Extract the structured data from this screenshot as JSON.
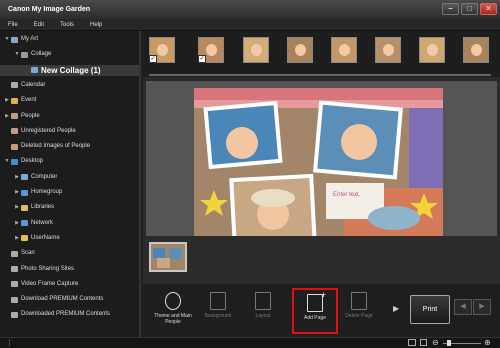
{
  "window": {
    "title": "Canon My Image Garden"
  },
  "menu": [
    "File",
    "Edit",
    "Tools",
    "Help"
  ],
  "tree": [
    {
      "label": "My Art",
      "tri": "▼",
      "indent": 1,
      "color": "#8aa6cf"
    },
    {
      "label": "Collage",
      "tri": "▼",
      "indent": 2,
      "color": "#9b9b9b"
    },
    {
      "label": "New Collage (1)",
      "tri": "",
      "indent": 3,
      "color": "#7da7d9",
      "selected": true
    },
    {
      "label": "Calendar",
      "tri": "",
      "indent": 1,
      "color": "#aaaaaa"
    },
    {
      "label": "Event",
      "tri": "▶",
      "indent": 1,
      "color": "#e0b04a"
    },
    {
      "label": "People",
      "tri": "▶",
      "indent": 1,
      "color": "#c59a80"
    },
    {
      "label": "Unregistered People",
      "tri": "",
      "indent": 1,
      "color": "#c59a80"
    },
    {
      "label": "Deleted Images of People",
      "tri": "",
      "indent": 1,
      "color": "#c59a80"
    },
    {
      "label": "Desktop",
      "tri": "▼",
      "indent": 1,
      "color": "#4a88d6"
    },
    {
      "label": "Computer",
      "tri": "▶",
      "indent": 2,
      "color": "#7fa8d6"
    },
    {
      "label": "Homegroup",
      "tri": "▶",
      "indent": 2,
      "color": "#5a96d6"
    },
    {
      "label": "Libraries",
      "tri": "▶",
      "indent": 2,
      "color": "#e0c050"
    },
    {
      "label": "Network",
      "tri": "▶",
      "indent": 2,
      "color": "#5a96d6"
    },
    {
      "label": "UserName",
      "tri": "▶",
      "indent": 2,
      "color": "#e0c050"
    },
    {
      "label": "Scan",
      "tri": "",
      "indent": 1,
      "color": "#aaaaaa"
    },
    {
      "label": "Photo Sharing Sites",
      "tri": "",
      "indent": 1,
      "color": "#aaaaaa"
    },
    {
      "label": "Video Frame Capture",
      "tri": "",
      "indent": 1,
      "color": "#aaaaaa"
    },
    {
      "label": "Download PREMIUM Contents",
      "tri": "",
      "indent": 1,
      "color": "#aaaaaa"
    },
    {
      "label": "Downloaded PREMIUM Contents",
      "tri": "",
      "indent": 1,
      "color": "#aaaaaa"
    }
  ],
  "canvas": {
    "text_placeholder": "Enter text."
  },
  "toolbar": {
    "theme": "Theme and Main People",
    "background": "Background",
    "layout": "Layout",
    "add_page": "Add Page",
    "delete_page": "Delete Page",
    "print": "Print"
  },
  "colors": {
    "highlight": "#e01010",
    "bg": "#202020"
  }
}
